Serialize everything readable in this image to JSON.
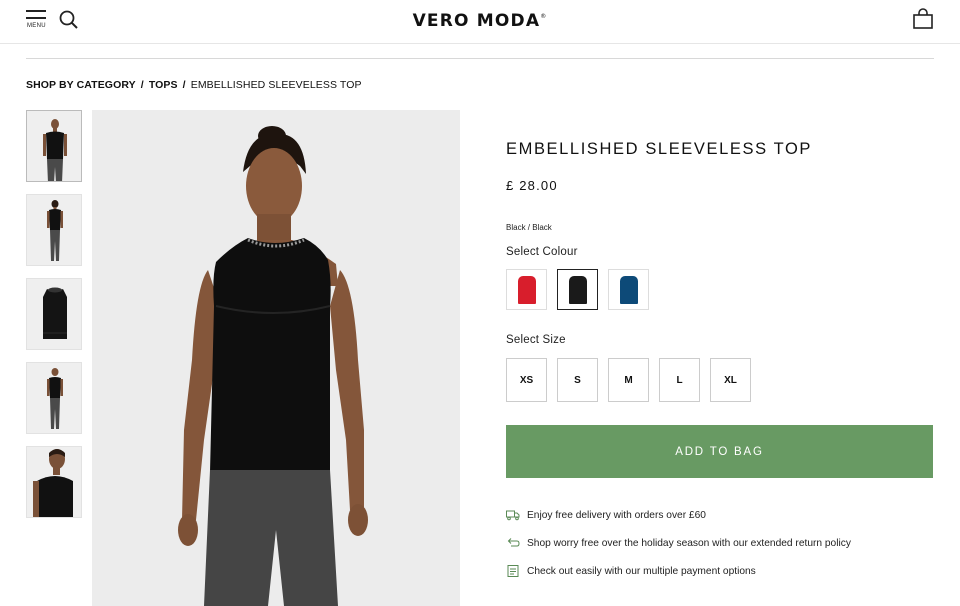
{
  "header": {
    "menu_label": "MENU",
    "logo_text": "VERO MODA",
    "logo_mark": "®"
  },
  "breadcrumb": {
    "items": [
      "SHOP BY CATEGORY",
      "TOPS"
    ],
    "separator": "/",
    "current": "EMBELLISHED SLEEVELESS TOP"
  },
  "product": {
    "title": "EMBELLISHED SLEEVELESS TOP",
    "price": "£ 28.00",
    "color_name": "Black / Black",
    "select_colour_label": "Select Colour",
    "colours": [
      {
        "name": "red",
        "hex": "#d81e2c",
        "selected": false
      },
      {
        "name": "black",
        "hex": "#1a1a1a",
        "selected": true
      },
      {
        "name": "navy",
        "hex": "#0d4a78",
        "selected": false
      }
    ],
    "select_size_label": "Select Size",
    "sizes": [
      "XS",
      "S",
      "M",
      "L",
      "XL"
    ],
    "add_to_bag_label": "ADD TO BAG"
  },
  "perks": [
    {
      "icon": "truck-icon",
      "text": "Enjoy free delivery with orders over £60"
    },
    {
      "icon": "return-icon",
      "text": "Shop worry free over the holiday season with our extended return policy"
    },
    {
      "icon": "payment-icon",
      "text": "Check out easily with our multiple payment options"
    }
  ],
  "colors": {
    "accent_green": "#689a63",
    "text": "#111111"
  }
}
